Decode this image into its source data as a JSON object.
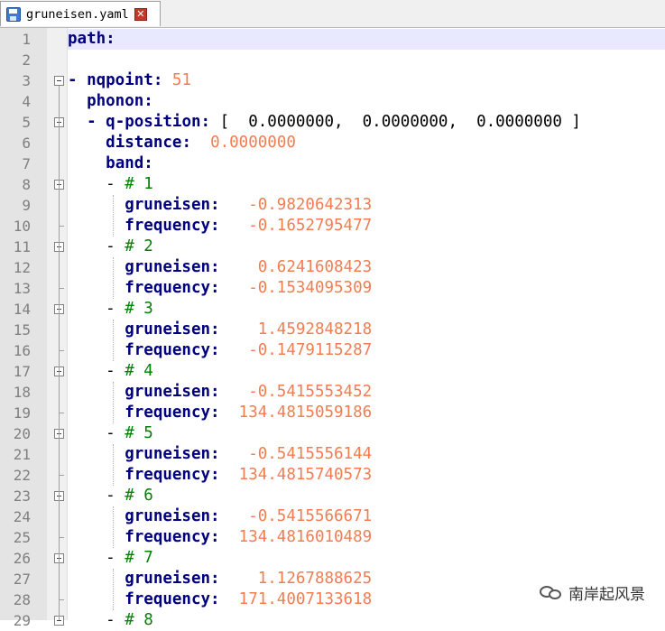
{
  "tab": {
    "filename": "gruneisen.yaml",
    "close_glyph": "✕",
    "save_icon": "save-icon"
  },
  "watermark": {
    "text": "南岸起风景",
    "icon": "wechat-icon"
  },
  "lines": [
    {
      "n": "1",
      "tokens": [
        {
          "t": "path:",
          "c": "k"
        }
      ]
    },
    {
      "n": "2",
      "tokens": []
    },
    {
      "n": "3",
      "tokens": [
        {
          "t": "- ",
          "c": "k"
        },
        {
          "t": "nqpoint:",
          "c": "k"
        },
        {
          "t": " ",
          "c": "p"
        },
        {
          "t": "51",
          "c": "n"
        }
      ]
    },
    {
      "n": "4",
      "tokens": [
        {
          "t": "  ",
          "c": "p"
        },
        {
          "t": "phonon:",
          "c": "k"
        }
      ]
    },
    {
      "n": "5",
      "tokens": [
        {
          "t": "  - ",
          "c": "k"
        },
        {
          "t": "q-position:",
          "c": "k"
        },
        {
          "t": " [  0.0000000,  0.0000000,  0.0000000 ]",
          "c": "p"
        }
      ]
    },
    {
      "n": "6",
      "tokens": [
        {
          "t": "    ",
          "c": "p"
        },
        {
          "t": "distance:",
          "c": "k"
        },
        {
          "t": "  ",
          "c": "p"
        },
        {
          "t": "0.0000000",
          "c": "n"
        }
      ]
    },
    {
      "n": "7",
      "tokens": [
        {
          "t": "    ",
          "c": "p"
        },
        {
          "t": "band:",
          "c": "k"
        }
      ]
    },
    {
      "n": "8",
      "tokens": [
        {
          "t": "    - ",
          "c": "p"
        },
        {
          "t": "# 1",
          "c": "c"
        }
      ]
    },
    {
      "n": "9",
      "tokens": [
        {
          "t": "      ",
          "c": "p"
        },
        {
          "t": "gruneisen:",
          "c": "k"
        },
        {
          "t": "   ",
          "c": "p"
        },
        {
          "t": "-0.9820642313",
          "c": "n"
        }
      ]
    },
    {
      "n": "10",
      "tokens": [
        {
          "t": "      ",
          "c": "p"
        },
        {
          "t": "frequency:",
          "c": "k"
        },
        {
          "t": "   ",
          "c": "p"
        },
        {
          "t": "-0.1652795477",
          "c": "n"
        }
      ]
    },
    {
      "n": "11",
      "tokens": [
        {
          "t": "    - ",
          "c": "p"
        },
        {
          "t": "# 2",
          "c": "c"
        }
      ]
    },
    {
      "n": "12",
      "tokens": [
        {
          "t": "      ",
          "c": "p"
        },
        {
          "t": "gruneisen:",
          "c": "k"
        },
        {
          "t": "    ",
          "c": "p"
        },
        {
          "t": "0.6241608423",
          "c": "n"
        }
      ]
    },
    {
      "n": "13",
      "tokens": [
        {
          "t": "      ",
          "c": "p"
        },
        {
          "t": "frequency:",
          "c": "k"
        },
        {
          "t": "   ",
          "c": "p"
        },
        {
          "t": "-0.1534095309",
          "c": "n"
        }
      ]
    },
    {
      "n": "14",
      "tokens": [
        {
          "t": "    - ",
          "c": "p"
        },
        {
          "t": "# 3",
          "c": "c"
        }
      ]
    },
    {
      "n": "15",
      "tokens": [
        {
          "t": "      ",
          "c": "p"
        },
        {
          "t": "gruneisen:",
          "c": "k"
        },
        {
          "t": "    ",
          "c": "p"
        },
        {
          "t": "1.4592848218",
          "c": "n"
        }
      ]
    },
    {
      "n": "16",
      "tokens": [
        {
          "t": "      ",
          "c": "p"
        },
        {
          "t": "frequency:",
          "c": "k"
        },
        {
          "t": "   ",
          "c": "p"
        },
        {
          "t": "-0.1479115287",
          "c": "n"
        }
      ]
    },
    {
      "n": "17",
      "tokens": [
        {
          "t": "    - ",
          "c": "p"
        },
        {
          "t": "# 4",
          "c": "c"
        }
      ]
    },
    {
      "n": "18",
      "tokens": [
        {
          "t": "      ",
          "c": "p"
        },
        {
          "t": "gruneisen:",
          "c": "k"
        },
        {
          "t": "   ",
          "c": "p"
        },
        {
          "t": "-0.5415553452",
          "c": "n"
        }
      ]
    },
    {
      "n": "19",
      "tokens": [
        {
          "t": "      ",
          "c": "p"
        },
        {
          "t": "frequency:",
          "c": "k"
        },
        {
          "t": "  ",
          "c": "p"
        },
        {
          "t": "134.4815059186",
          "c": "n"
        }
      ]
    },
    {
      "n": "20",
      "tokens": [
        {
          "t": "    - ",
          "c": "p"
        },
        {
          "t": "# 5",
          "c": "c"
        }
      ]
    },
    {
      "n": "21",
      "tokens": [
        {
          "t": "      ",
          "c": "p"
        },
        {
          "t": "gruneisen:",
          "c": "k"
        },
        {
          "t": "   ",
          "c": "p"
        },
        {
          "t": "-0.5415556144",
          "c": "n"
        }
      ]
    },
    {
      "n": "22",
      "tokens": [
        {
          "t": "      ",
          "c": "p"
        },
        {
          "t": "frequency:",
          "c": "k"
        },
        {
          "t": "  ",
          "c": "p"
        },
        {
          "t": "134.4815740573",
          "c": "n"
        }
      ]
    },
    {
      "n": "23",
      "tokens": [
        {
          "t": "    - ",
          "c": "p"
        },
        {
          "t": "# 6",
          "c": "c"
        }
      ]
    },
    {
      "n": "24",
      "tokens": [
        {
          "t": "      ",
          "c": "p"
        },
        {
          "t": "gruneisen:",
          "c": "k"
        },
        {
          "t": "   ",
          "c": "p"
        },
        {
          "t": "-0.5415566671",
          "c": "n"
        }
      ]
    },
    {
      "n": "25",
      "tokens": [
        {
          "t": "      ",
          "c": "p"
        },
        {
          "t": "frequency:",
          "c": "k"
        },
        {
          "t": "  ",
          "c": "p"
        },
        {
          "t": "134.4816010489",
          "c": "n"
        }
      ]
    },
    {
      "n": "26",
      "tokens": [
        {
          "t": "    - ",
          "c": "p"
        },
        {
          "t": "# 7",
          "c": "c"
        }
      ]
    },
    {
      "n": "27",
      "tokens": [
        {
          "t": "      ",
          "c": "p"
        },
        {
          "t": "gruneisen:",
          "c": "k"
        },
        {
          "t": "    ",
          "c": "p"
        },
        {
          "t": "1.1267888625",
          "c": "n"
        }
      ]
    },
    {
      "n": "28",
      "tokens": [
        {
          "t": "      ",
          "c": "p"
        },
        {
          "t": "frequency:",
          "c": "k"
        },
        {
          "t": "  ",
          "c": "p"
        },
        {
          "t": "171.4007133618",
          "c": "n"
        }
      ]
    },
    {
      "n": "29",
      "tokens": [
        {
          "t": "    - ",
          "c": "p"
        },
        {
          "t": "# 8",
          "c": "c"
        }
      ]
    }
  ],
  "colors": {
    "keyword": "#00007f",
    "number": "#f27d50",
    "comment": "#008000",
    "current_line": "#e8e8ff",
    "gutter": "#e4e4e4"
  }
}
